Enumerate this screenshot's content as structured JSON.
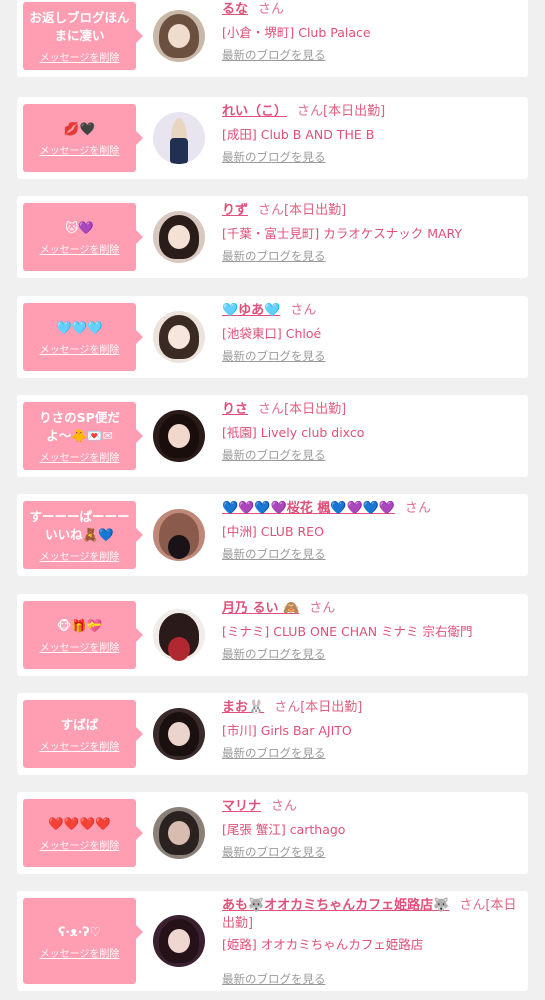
{
  "colors": {
    "accent": "#e0507a",
    "bubble": "#ff9eb2",
    "background": "#f0f0f0",
    "muted": "#9a9a9a"
  },
  "entries": [
    {
      "message": "お返しブログほんまに凄い",
      "delete_label": "メッセージを削除",
      "name": "るな",
      "honorific": "さん",
      "status": "",
      "shop": "[小倉・堺町] Club Palace",
      "blog_link": "最新のブログを見る"
    },
    {
      "message": "💋🖤",
      "delete_label": "メッセージを削除",
      "name": "れい（こ）",
      "honorific": "さん",
      "status": "[本日出勤]",
      "shop": "[成田] Club B AND THE B",
      "blog_link": "最新のブログを見る"
    },
    {
      "message": "🐱💜",
      "delete_label": "メッセージを削除",
      "name": "りず",
      "honorific": "さん",
      "status": "[本日出勤]",
      "shop": "[千葉・富士見町] カラオケスナック MARY",
      "blog_link": "最新のブログを見る"
    },
    {
      "message": "🩵🩵🩵",
      "delete_label": "メッセージを削除",
      "name": "🩵ゆあ🩵",
      "honorific": "さん",
      "status": "",
      "shop": "[池袋東口] Chloé",
      "blog_link": "最新のブログを見る"
    },
    {
      "message": "りさのSP便だよ〜🐥💌✉",
      "delete_label": "メッセージを削除",
      "name": "りさ",
      "honorific": "さん",
      "status": "[本日出勤]",
      "shop": "[祇園] Lively club dixco",
      "blog_link": "最新のブログを見る"
    },
    {
      "message": "すーーーぱーーーいいね🧸💙",
      "delete_label": "メッセージを削除",
      "name": "💙💜💙💜桜花 楓💙💜💙💜",
      "honorific": "さん",
      "status": "",
      "shop": "[中洲] CLUB REO",
      "blog_link": "最新のブログを見る"
    },
    {
      "message": "🐵🎁💝",
      "delete_label": "メッセージを削除",
      "name": "月乃 るい 🙈",
      "honorific": "さん",
      "status": "",
      "shop": "[ミナミ] CLUB ONE CHAN ミナミ 宗右衛門",
      "blog_link": "最新のブログを見る"
    },
    {
      "message": "すばば",
      "delete_label": "メッセージを削除",
      "name": "まお🐰",
      "honorific": "さん",
      "status": "[本日出勤]",
      "shop": "[市川] Girls Bar AJITO",
      "blog_link": "最新のブログを見る"
    },
    {
      "message": "❤️❤️❤️❤️",
      "delete_label": "メッセージを削除",
      "name": "マリナ",
      "honorific": "さん",
      "status": "",
      "shop": "[尾張 蟹江] carthago",
      "blog_link": "最新のブログを見る"
    },
    {
      "message": "ʕ·ᴥ·ʔ♡",
      "delete_label": "メッセージを削除",
      "name": "あも🐺オオカミちゃんカフェ姫路店🐺",
      "honorific": "さん",
      "status": "[本日出勤]",
      "shop": "[姫路] オオカミちゃんカフェ姫路店",
      "blog_link": "最新のブログを見る"
    }
  ]
}
